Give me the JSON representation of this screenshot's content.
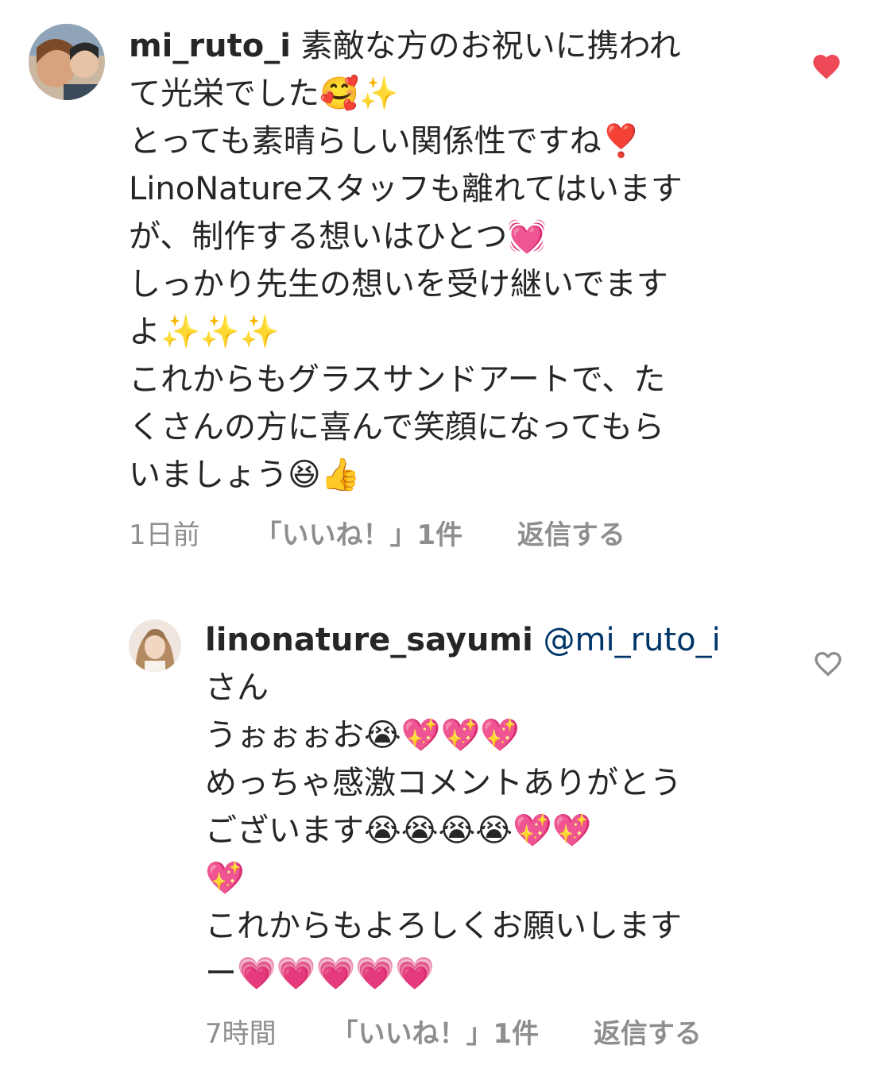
{
  "comments": [
    {
      "username": "mi_ruto_i",
      "lines": [
        "素敵な方のお祝いに携われ",
        "て光栄でした🥰✨",
        "とっても素晴らしい関係性ですね❣️",
        "LinoNatureスタッフも離れてはいます",
        "が、制作する想いはひとつ💓",
        "しっかり先生の想いを受け継いでます",
        "よ✨✨✨",
        "これからもグラスサンドアートで、た",
        "くさんの方に喜んで笑顔になってもら",
        "いましょう😆👍"
      ],
      "time": "1日前",
      "likes_label": "「いいね！」1件",
      "reply_label": "返信する",
      "liked": true
    },
    {
      "username": "linonature_sayumi",
      "mention": "@mi_ruto_i",
      "lines": [
        "さん",
        "うぉぉぉお😭💖💖💖",
        "めっちゃ感激コメントありがとう",
        "ございます😭😭😭😭💖💖",
        "💖",
        "これからもよろしくお願いします",
        "ー💗💗💗💗💗"
      ],
      "time": "7時間",
      "likes_label": "「いいね！」1件",
      "reply_label": "返信する",
      "liked": false
    }
  ],
  "icons": {
    "like_filled": "heart-filled-icon",
    "like_outline": "heart-outline-icon"
  },
  "colors": {
    "like_red": "#ed4956",
    "meta_gray": "#8e8e8e",
    "mention_blue": "#003569",
    "text": "#262626"
  }
}
